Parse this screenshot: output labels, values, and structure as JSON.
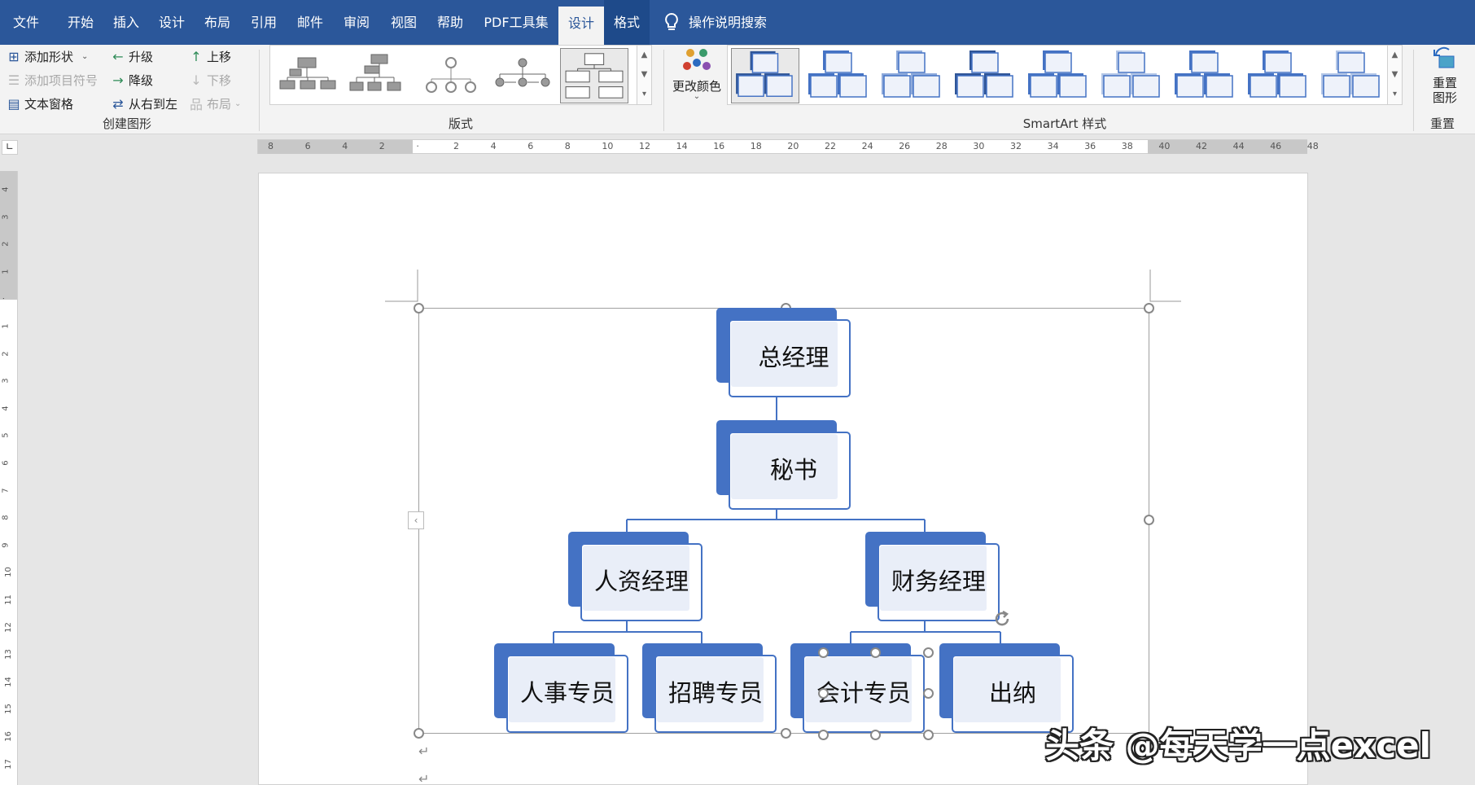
{
  "menu": {
    "items": [
      "文件",
      "开始",
      "插入",
      "设计",
      "布局",
      "引用",
      "邮件",
      "审阅",
      "视图",
      "帮助",
      "PDF工具集",
      "设计",
      "格式"
    ],
    "search_label": "操作说明搜索"
  },
  "ribbon": {
    "create_graphic": {
      "add_shape": "添加形状",
      "add_bullet": "添加项目符号",
      "text_pane": "文本窗格",
      "promote": "升级",
      "demote": "降级",
      "right_to_left": "从右到左",
      "move_up": "上移",
      "move_down": "下移",
      "layout": "布局",
      "group_label": "创建图形"
    },
    "layouts": {
      "group_label": "版式"
    },
    "change_colors": "更改颜色",
    "styles": {
      "group_label": "SmartArt 样式"
    },
    "reset": {
      "button": "重置图形",
      "group_label": "重置"
    }
  },
  "ruler": {
    "h_labels": [
      "8",
      "6",
      "4",
      "2",
      "",
      "2",
      "4",
      "6",
      "8",
      "10",
      "12",
      "14",
      "16",
      "18",
      "20",
      "22",
      "24",
      "26",
      "28",
      "30",
      "32",
      "34",
      "36",
      "38",
      "40",
      "42",
      "44",
      "46",
      "48"
    ],
    "v_labels": [
      "4",
      "3",
      "2",
      "1",
      "",
      "1",
      "2",
      "3",
      "4",
      "5",
      "6",
      "7",
      "8",
      "9",
      "10",
      "11",
      "12",
      "13",
      "14",
      "15",
      "16",
      "17"
    ]
  },
  "smartart": {
    "nodes": {
      "ceo": "总经理",
      "secretary": "秘书",
      "hr_manager": "人资经理",
      "finance_manager": "财务经理",
      "hr_specialist": "人事专员",
      "recruiter": "招聘专员",
      "accountant": "会计专员",
      "cashier": "出纳"
    }
  },
  "colors": {
    "accent": "#2b579a",
    "node_fill": "#4472c4",
    "node_inner": "#e9eef8"
  },
  "watermark": "头条 @每天学一点excel"
}
